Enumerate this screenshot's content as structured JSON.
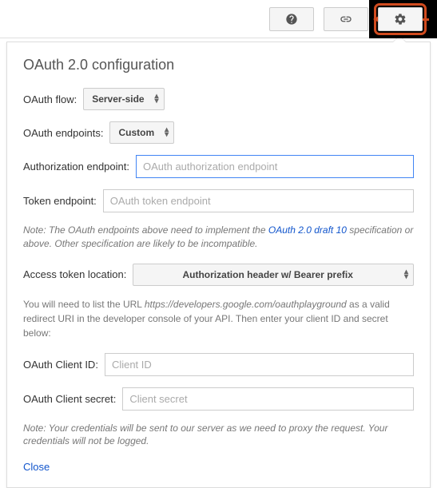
{
  "toolbar": {
    "help_icon": "help-icon",
    "link_icon": "link-icon",
    "gear_icon": "gear-icon"
  },
  "panel": {
    "title": "OAuth 2.0 configuration",
    "oauth_flow_label": "OAuth flow:",
    "oauth_flow_value": "Server-side",
    "oauth_endpoints_label": "OAuth endpoints:",
    "oauth_endpoints_value": "Custom",
    "auth_endpoint_label": "Authorization endpoint:",
    "auth_endpoint_placeholder": "OAuth authorization endpoint",
    "auth_endpoint_value": "",
    "token_endpoint_label": "Token endpoint:",
    "token_endpoint_placeholder": "OAuth token endpoint",
    "token_endpoint_value": "",
    "note1_prefix": "Note: The OAuth endpoints above need to implement the ",
    "note1_link": "OAuth 2.0 draft 10",
    "note1_suffix": " specification or above. Other specification are likely to be incompatible.",
    "access_token_label": "Access token location:",
    "access_token_value": "Authorization header w/ Bearer prefix",
    "desc_prefix": "You will need to list the URL ",
    "desc_url": "https://developers.google.com/oauthplayground",
    "desc_suffix": " as a valid redirect URI in the developer console of your API. Then enter your client ID and secret below:",
    "client_id_label": "OAuth Client ID:",
    "client_id_placeholder": "Client ID",
    "client_id_value": "",
    "client_secret_label": "OAuth Client secret:",
    "client_secret_placeholder": "Client secret",
    "client_secret_value": "",
    "note2": "Note: Your credentials will be sent to our server as we need to proxy the request. Your credentials will not be logged.",
    "close": "Close"
  }
}
